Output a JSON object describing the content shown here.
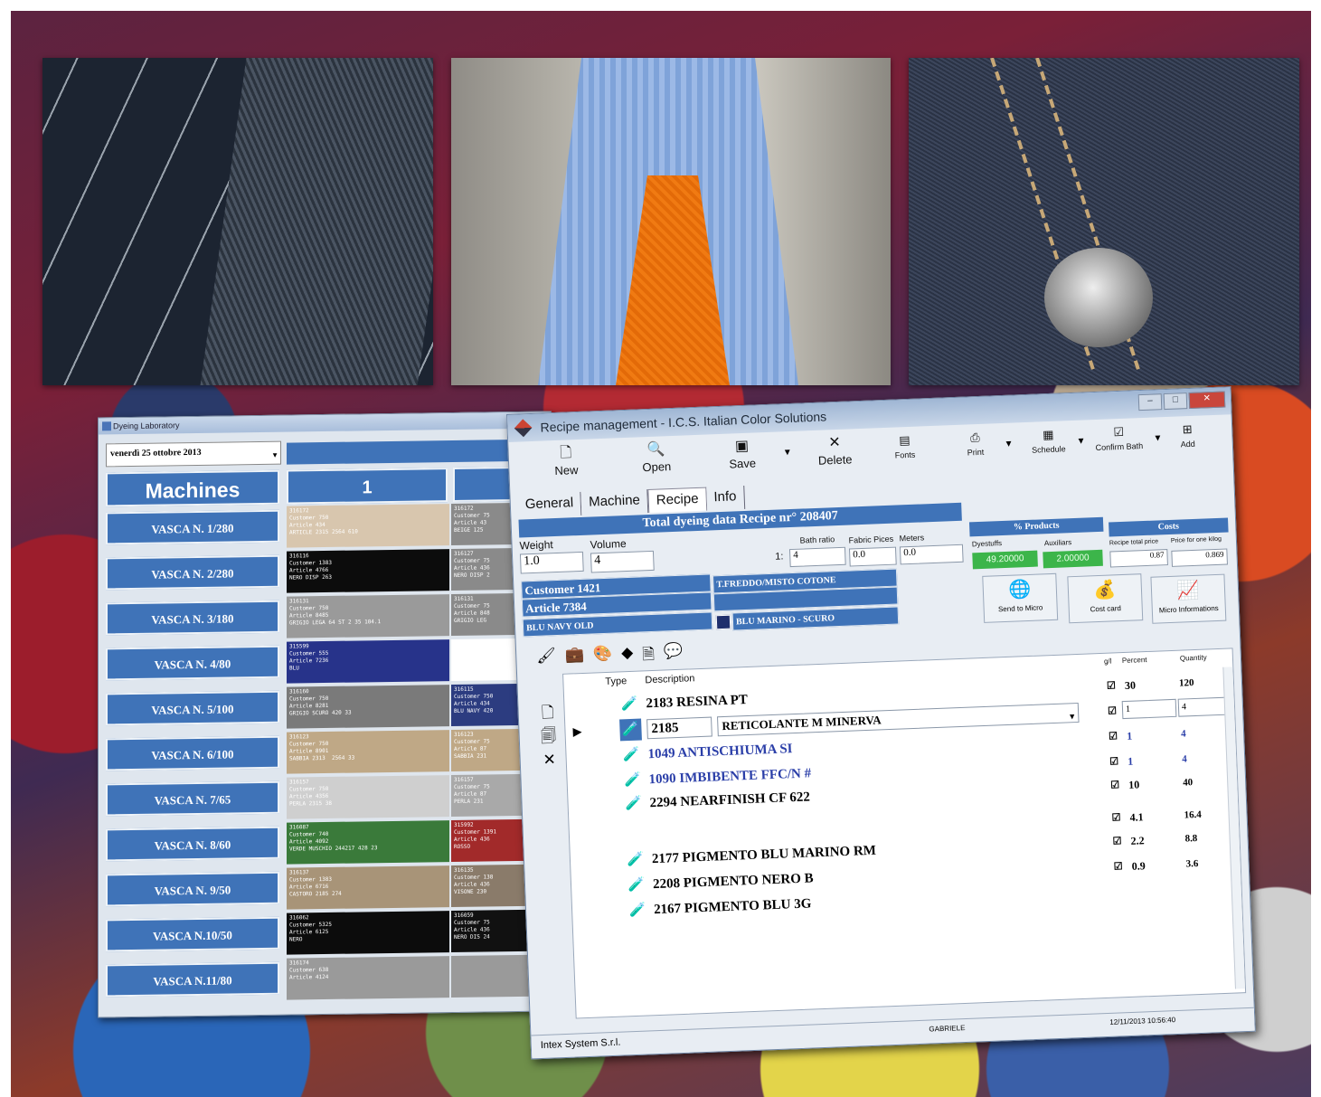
{
  "lab_window": {
    "title": "Dyeing Laboratory",
    "date": "venerdì  25  ottobre  2013",
    "machines_header": "Machines",
    "column_1_header": "1",
    "machines": [
      {
        "label": "VASCA N. 1/280",
        "b1": "316172\nCustomer 750\nArticle 434\nARTICLE 2315 2564 610",
        "c1": "#d8c6ae",
        "t1": "#fff",
        "b2": "316172\nCustomer 75\nArticle 43\nBEIGE 125",
        "c2": "#8a8a8a",
        "t2": "#fff"
      },
      {
        "label": "VASCA N. 2/280",
        "b1": "316116\nCustomer 1383\nArticle 4766\nNERO DISP 263",
        "c1": "#0c0c0c",
        "t1": "#fff",
        "b2": "316127\nCustomer 75\nArticle 436\nNERO DISP 2",
        "c2": "#8a8a8a",
        "t2": "#fff"
      },
      {
        "label": "VASCA N. 3/180",
        "b1": "316131\nCustomer 750\nArticle 8485\nGRIGIO LEGA 64 ST 2 35 104.1",
        "c1": "#9a9a9a",
        "t1": "#fff",
        "b2": "316131\nCustomer 75\nArticle 848\nGRIGIO LEG",
        "c2": "#8a8a8a",
        "t2": "#fff"
      },
      {
        "label": "VASCA N. 4/80",
        "b1": "315599\nCustomer 555\nArticle 7236\nBLU",
        "c1": "#27338a",
        "t1": "#fff",
        "b2": "",
        "c2": "#ffffff",
        "t2": "#000"
      },
      {
        "label": "VASCA N. 5/100",
        "b1": "316160\nCustomer 750\nArticle 8281\nGRIGIO SCURO 420 33",
        "c1": "#7a7a7a",
        "t1": "#fff",
        "b2": "316115\nCustomer 750\nArticle 434\nBLU NAVY 420",
        "c2": "#2c3c80",
        "t2": "#fff"
      },
      {
        "label": "VASCA N. 6/100",
        "b1": "316123\nCustomer 750\nArticle 8901\nSABBIA 2313  2564 33",
        "c1": "#bfa886",
        "t1": "#fff",
        "b2": "316123\nCustomer 75\nArticle 87\nSABBIA 231",
        "c2": "#bfa886",
        "t2": "#fff"
      },
      {
        "label": "VASCA N. 7/65",
        "b1": "316157\nCustomer 750\nArticle 4356\nPERLA 2315 38",
        "c1": "#cfcfcf",
        "t1": "#fff",
        "b2": "316157\nCustomer 75\nArticle 87\nPERLA 231",
        "c2": "#a9a9a9",
        "t2": "#fff"
      },
      {
        "label": "VASCA N. 8/60",
        "b1": "316087\nCustomer 740\nArticle 4092\nVERDE MUSCHIO 244217 428 23",
        "c1": "#3a7a3a",
        "t1": "#fff",
        "b2": "315992\nCustomer 1391\nArticle 436\nROSSO",
        "c2": "#a22a2a",
        "t2": "#fff"
      },
      {
        "label": "VASCA N. 9/50",
        "b1": "316137\nCustomer 1383\nArticle 6716\nCASTORO 2185 274",
        "c1": "#a89478",
        "t1": "#fff",
        "b2": "316135\nCustomer 138\nArticle 436\nVISONE 230",
        "c2": "#8a7b6a",
        "t2": "#fff"
      },
      {
        "label": "VASCA N.10/50",
        "b1": "316062\nCustomer 5325\nArticle 6125\nNERO",
        "c1": "#0c0c0c",
        "t1": "#fff",
        "b2": "316059\nCustomer 75\nArticle 436\nNERO DIS 24",
        "c2": "#111111",
        "t2": "#fff"
      },
      {
        "label": "VASCA N.11/80",
        "b1": "316174\nCustomer 638\nArticle 4124",
        "c1": "#9a9a9a",
        "t1": "#fff",
        "b2": "",
        "c2": "#9a9a9a",
        "t2": "#fff"
      }
    ]
  },
  "recipe_window": {
    "title": "Recipe management - I.C.S. Italian Color Solutions",
    "toolbar": {
      "new": "New",
      "open": "Open",
      "save": "Save",
      "delete": "Delete",
      "fonts": "Fonts",
      "print": "Print",
      "schedule": "Schedule",
      "confirm_bath": "Confirm Bath",
      "add": "Add"
    },
    "tabs": [
      "General",
      "Machine",
      "Recipe",
      "Info"
    ],
    "total_band": "Total dyeing data Recipe nr° 208407",
    "weight_label": "Weight",
    "weight_value": "1.0",
    "volume_label": "Volume",
    "volume_value": "4",
    "bath_ratio_label": "Bath ratio",
    "bath_ratio_prefix": "1:",
    "bath_ratio_value": "4",
    "fabric_pieces_label": "Fabric Pices",
    "fabric_pieces_value": "0.0",
    "meters_label": "Meters",
    "meters_value": "0.0",
    "products_band": "% Products",
    "dyestuffs_label": "Dyestuffs",
    "dyestuffs_value": "49.20000",
    "auxiliars_label": "Auxiliars",
    "auxiliars_value": "2.00000",
    "costs_band": "Costs",
    "recipe_total_label": "Recipe total price",
    "recipe_total_value": "0.87",
    "price_label": "Price for one kilog",
    "price_value": "0.869",
    "customer": "Customer 1421",
    "article": "Article 7384",
    "color_code": "BLU NAVY   OLD",
    "fabric": "T.FREDDO/MISTO COTONE",
    "color_name": "BLU MARINO - SCURO",
    "send_to_micro": "Send to Micro",
    "cost_card": "Cost card",
    "micro_info": "Micro Informations",
    "grid_headers": {
      "type": "Type",
      "description": "Description",
      "gl": "g/l",
      "percent": "Percent",
      "quantity": "Quantity"
    },
    "rows": [
      {
        "desc": "2183 RESINA PT",
        "pct": "30",
        "qty": "120",
        "blue": false
      },
      {
        "code": "2185",
        "desc": "RETICOLANTE M MINERVA",
        "pct": "1",
        "qty": "4",
        "edit": true
      },
      {
        "desc": "1049 ANTISCHIUMA SI",
        "pct": "1",
        "qty": "4",
        "blue": true
      },
      {
        "desc": "1090 IMBIBENTE FFC/N #",
        "pct": "1",
        "qty": "4",
        "blue": true
      },
      {
        "desc": "2294 NEARFINISH CF 622",
        "pct": "10",
        "qty": "40",
        "blue": false
      },
      {
        "desc": "",
        "pct": "4.1",
        "qty": "16.4",
        "blue": false,
        "noicon": true
      },
      {
        "desc": "2177 PIGMENTO BLU MARINO RM",
        "pct": "2.2",
        "qty": "8.8",
        "blue": false
      },
      {
        "desc": "2208 PIGMENTO NERO B",
        "pct": "0.9",
        "qty": "3.6",
        "blue": false
      },
      {
        "desc": "2167 PIGMENTO BLU 3G",
        "pct": "",
        "qty": "",
        "blue": false
      }
    ],
    "status_user": "GABRIELE",
    "status_datetime": "12/11/2013 10:56:40",
    "company": "Intex System S.r.l."
  }
}
